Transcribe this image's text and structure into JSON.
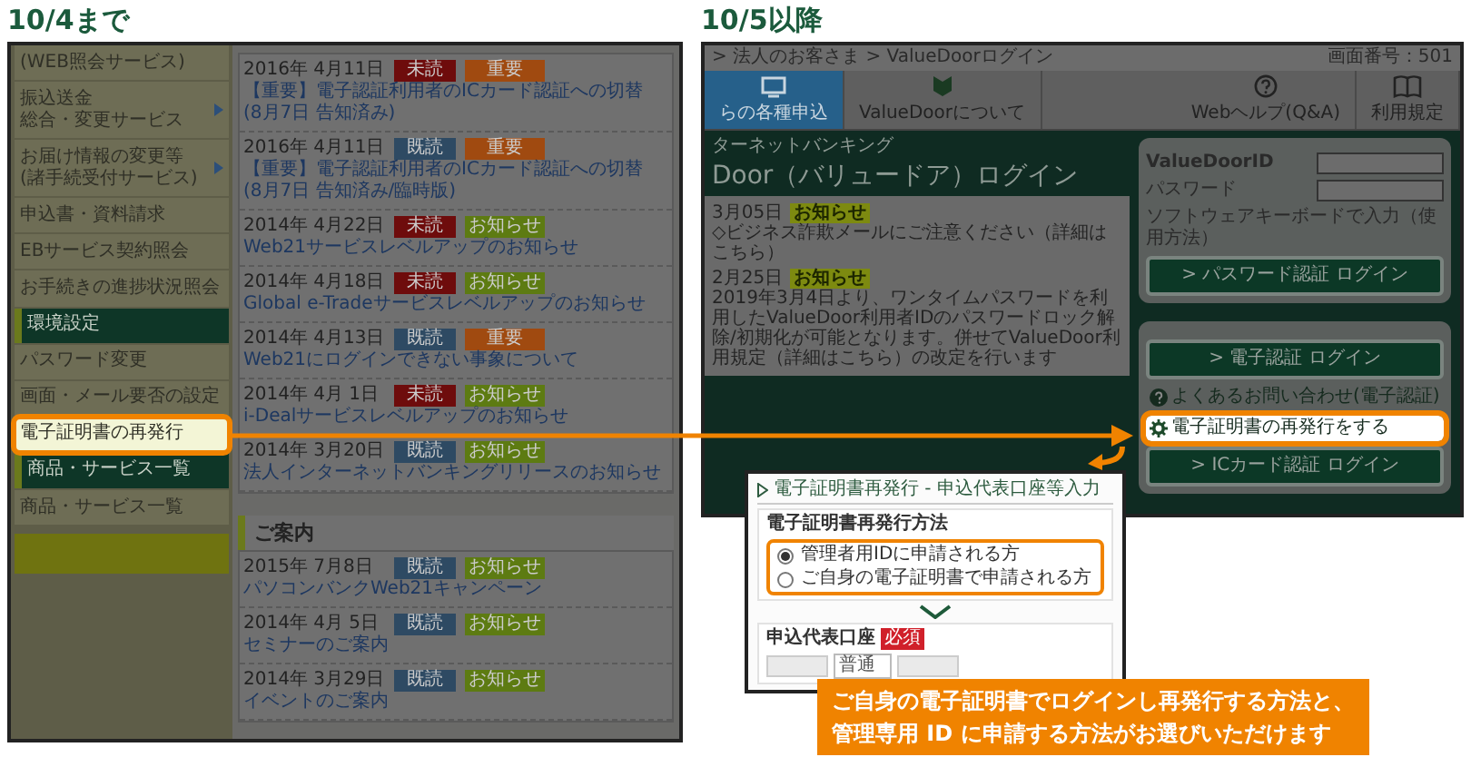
{
  "before": {
    "heading": "10/4まで",
    "sidebar": [
      {
        "kind": "item",
        "lines": [
          "(WEB照会サービス)"
        ],
        "submenu": false,
        "highlighted": false
      },
      {
        "kind": "item",
        "lines": [
          "振込送金",
          "総合・変更サービス"
        ],
        "submenu": true,
        "highlighted": false
      },
      {
        "kind": "item",
        "lines": [
          "お届け情報の変更等",
          "(諸手続受付サービス)"
        ],
        "submenu": true,
        "highlighted": false
      },
      {
        "kind": "item",
        "lines": [
          "申込書・資料請求"
        ],
        "submenu": false,
        "highlighted": false
      },
      {
        "kind": "item",
        "lines": [
          "EBサービス契約照会"
        ],
        "submenu": false,
        "highlighted": false
      },
      {
        "kind": "item",
        "lines": [
          "お手続きの進捗状況照会"
        ],
        "submenu": false,
        "highlighted": false
      },
      {
        "kind": "header",
        "lines": [
          "環境設定"
        ],
        "submenu": false,
        "highlighted": false
      },
      {
        "kind": "item",
        "lines": [
          "パスワード変更"
        ],
        "submenu": false,
        "highlighted": false
      },
      {
        "kind": "item",
        "lines": [
          "画面・メール要否の設定"
        ],
        "submenu": false,
        "highlighted": false
      },
      {
        "kind": "item",
        "lines": [
          "電子証明書の再発行"
        ],
        "submenu": false,
        "highlighted": true
      },
      {
        "kind": "header",
        "lines": [
          "商品・サービス一覧"
        ],
        "submenu": false,
        "highlighted": false
      },
      {
        "kind": "item",
        "lines": [
          "商品・サービス一覧"
        ],
        "submenu": false,
        "highlighted": false
      },
      {
        "kind": "banner"
      }
    ],
    "news": [
      {
        "date": "2016年 4月11日",
        "status": "未読",
        "read": false,
        "tag": "重要",
        "kind": "important",
        "title": "【重要】電子認証利用者のICカード認証への切替",
        "note": "(8月7日 告知済み)"
      },
      {
        "date": "2016年 4月11日",
        "status": "既読",
        "read": true,
        "tag": "重要",
        "kind": "important",
        "title": "【重要】電子認証利用者のICカード認証への切替",
        "note": "(8月7日 告知済み/臨時版)"
      },
      {
        "date": "2014年 4月22日",
        "status": "未読",
        "read": false,
        "tag": "お知らせ",
        "kind": "notice",
        "title": "Web21サービスレベルアップのお知らせ"
      },
      {
        "date": "2014年 4月18日",
        "status": "未読",
        "read": false,
        "tag": "お知らせ",
        "kind": "notice",
        "title": "Global e-Tradeサービスレベルアップのお知らせ"
      },
      {
        "date": "2014年 4月13日",
        "status": "既読",
        "read": true,
        "tag": "重要",
        "kind": "important",
        "title": "Web21にログインできない事象について"
      },
      {
        "date": "2014年 4月 1日",
        "status": "未読",
        "read": false,
        "tag": "お知らせ",
        "kind": "notice",
        "title": "i-Dealサービスレベルアップのお知らせ"
      },
      {
        "date": "2014年 3月20日",
        "status": "既読",
        "read": true,
        "tag": "お知らせ",
        "kind": "notice",
        "title": "法人インターネットバンキングリリースのお知らせ"
      }
    ],
    "guide": {
      "title": "ご案内",
      "rows": [
        {
          "date": "2015年 7月8日",
          "status": "既読",
          "read": true,
          "tag": "お知らせ",
          "kind": "notice",
          "title": "パソコンバンクWeb21キャンペーン"
        },
        {
          "date": "2014年 4月 5日",
          "status": "既読",
          "read": true,
          "tag": "お知らせ",
          "kind": "notice",
          "title": "セミナーのご案内"
        },
        {
          "date": "2014年 3月29日",
          "status": "既読",
          "read": true,
          "tag": "お知らせ",
          "kind": "notice",
          "title": "イベントのご案内"
        }
      ]
    }
  },
  "after": {
    "heading": "10/5以降",
    "breadcrumb": "> 法人のお客さま > ValueDoorログイン",
    "screen_number": "画面番号：501",
    "nav_left": [
      {
        "label": "らの各種申込",
        "selected": true
      },
      {
        "label": "ValueDoorについて",
        "selected": false
      }
    ],
    "nav_right": [
      {
        "label": "Webヘルプ(Q&A)"
      },
      {
        "label": "利用規定"
      }
    ],
    "hero": {
      "subtitle": "ターネットバンキング",
      "title": "Door（バリュードア）ログイン"
    },
    "news": [
      {
        "date": "3月05日",
        "tag": "お知らせ",
        "text": "◇ビジネス詐欺メールにご注意ください（詳細はこちら）"
      },
      {
        "date": "2月25日",
        "tag": "お知らせ",
        "text": "2019年3月4日より、ワンタイムパスワードを利用したValueDoor利用者IDのパスワードロック解除/初期化が可能となります。併せてValueDoor利用規定（詳細はこちら）の改定を行います"
      }
    ],
    "login": {
      "id_label": "ValueDoorID",
      "password_label": "パスワード",
      "keyboard_note": "ソフトウェアキーボードで入力（使用方法）",
      "password_button": "> パスワード認証 ログイン",
      "cert_button": "> 電子認証 ログイン",
      "links": [
        {
          "label": "よくあるお問い合わせ(電子認証)",
          "highlighted": false
        },
        {
          "label": "電子証明書の再発行をする",
          "highlighted": true
        }
      ],
      "ic_button": "> ICカード認証 ログイン"
    },
    "form": {
      "title": "電子証明書再発行 - 申込代表口座等入力",
      "method_label": "電子証明書再発行方法",
      "options": [
        {
          "label": "管理者用IDに申請される方",
          "selected": true
        },
        {
          "label": "ご自身の電子証明書で申請される方",
          "selected": false
        }
      ],
      "account_label": "申込代表口座",
      "required_badge": "必須",
      "account_type": "普通"
    },
    "caption": [
      "ご自身の電子証明書でログインし再発行する方法と、",
      "管理専用 ID に申請する方法がお選びいただけます"
    ]
  }
}
